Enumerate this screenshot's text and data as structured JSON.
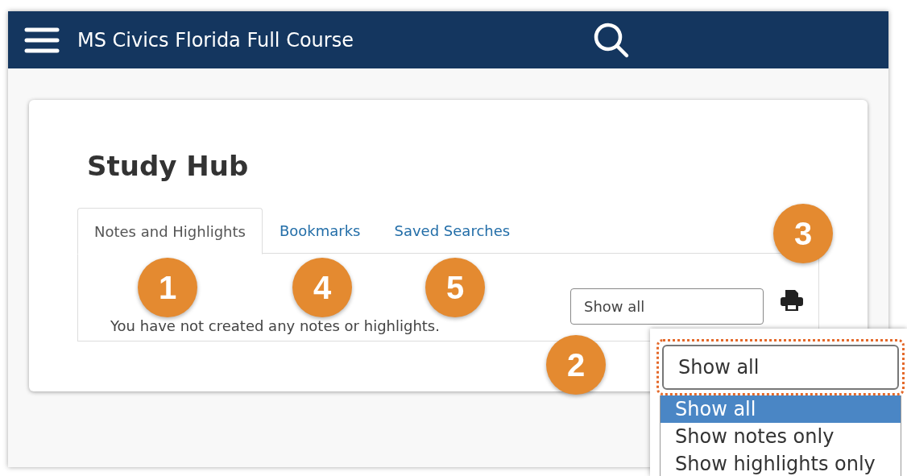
{
  "header": {
    "title": "MS Civics Florida Full Course"
  },
  "card": {
    "title": "Study Hub",
    "tabs": [
      {
        "label": "Notes and Highlights",
        "selected": true
      },
      {
        "label": "Bookmarks",
        "selected": false
      },
      {
        "label": "Saved Searches",
        "selected": false
      }
    ],
    "message": "You have not created any notes or highlights.",
    "filter": {
      "value": "Show all"
    }
  },
  "callouts": [
    {
      "label": "3"
    },
    {
      "label": "1"
    },
    {
      "label": "4"
    },
    {
      "label": "5"
    },
    {
      "label": "2"
    }
  ],
  "zoom_inset": {
    "select": {
      "value": "Show all"
    },
    "options": [
      {
        "label": "Show all",
        "selected": true
      },
      {
        "label": "Show notes only",
        "selected": false
      },
      {
        "label": "Show highlights only",
        "selected": false
      }
    ]
  }
}
